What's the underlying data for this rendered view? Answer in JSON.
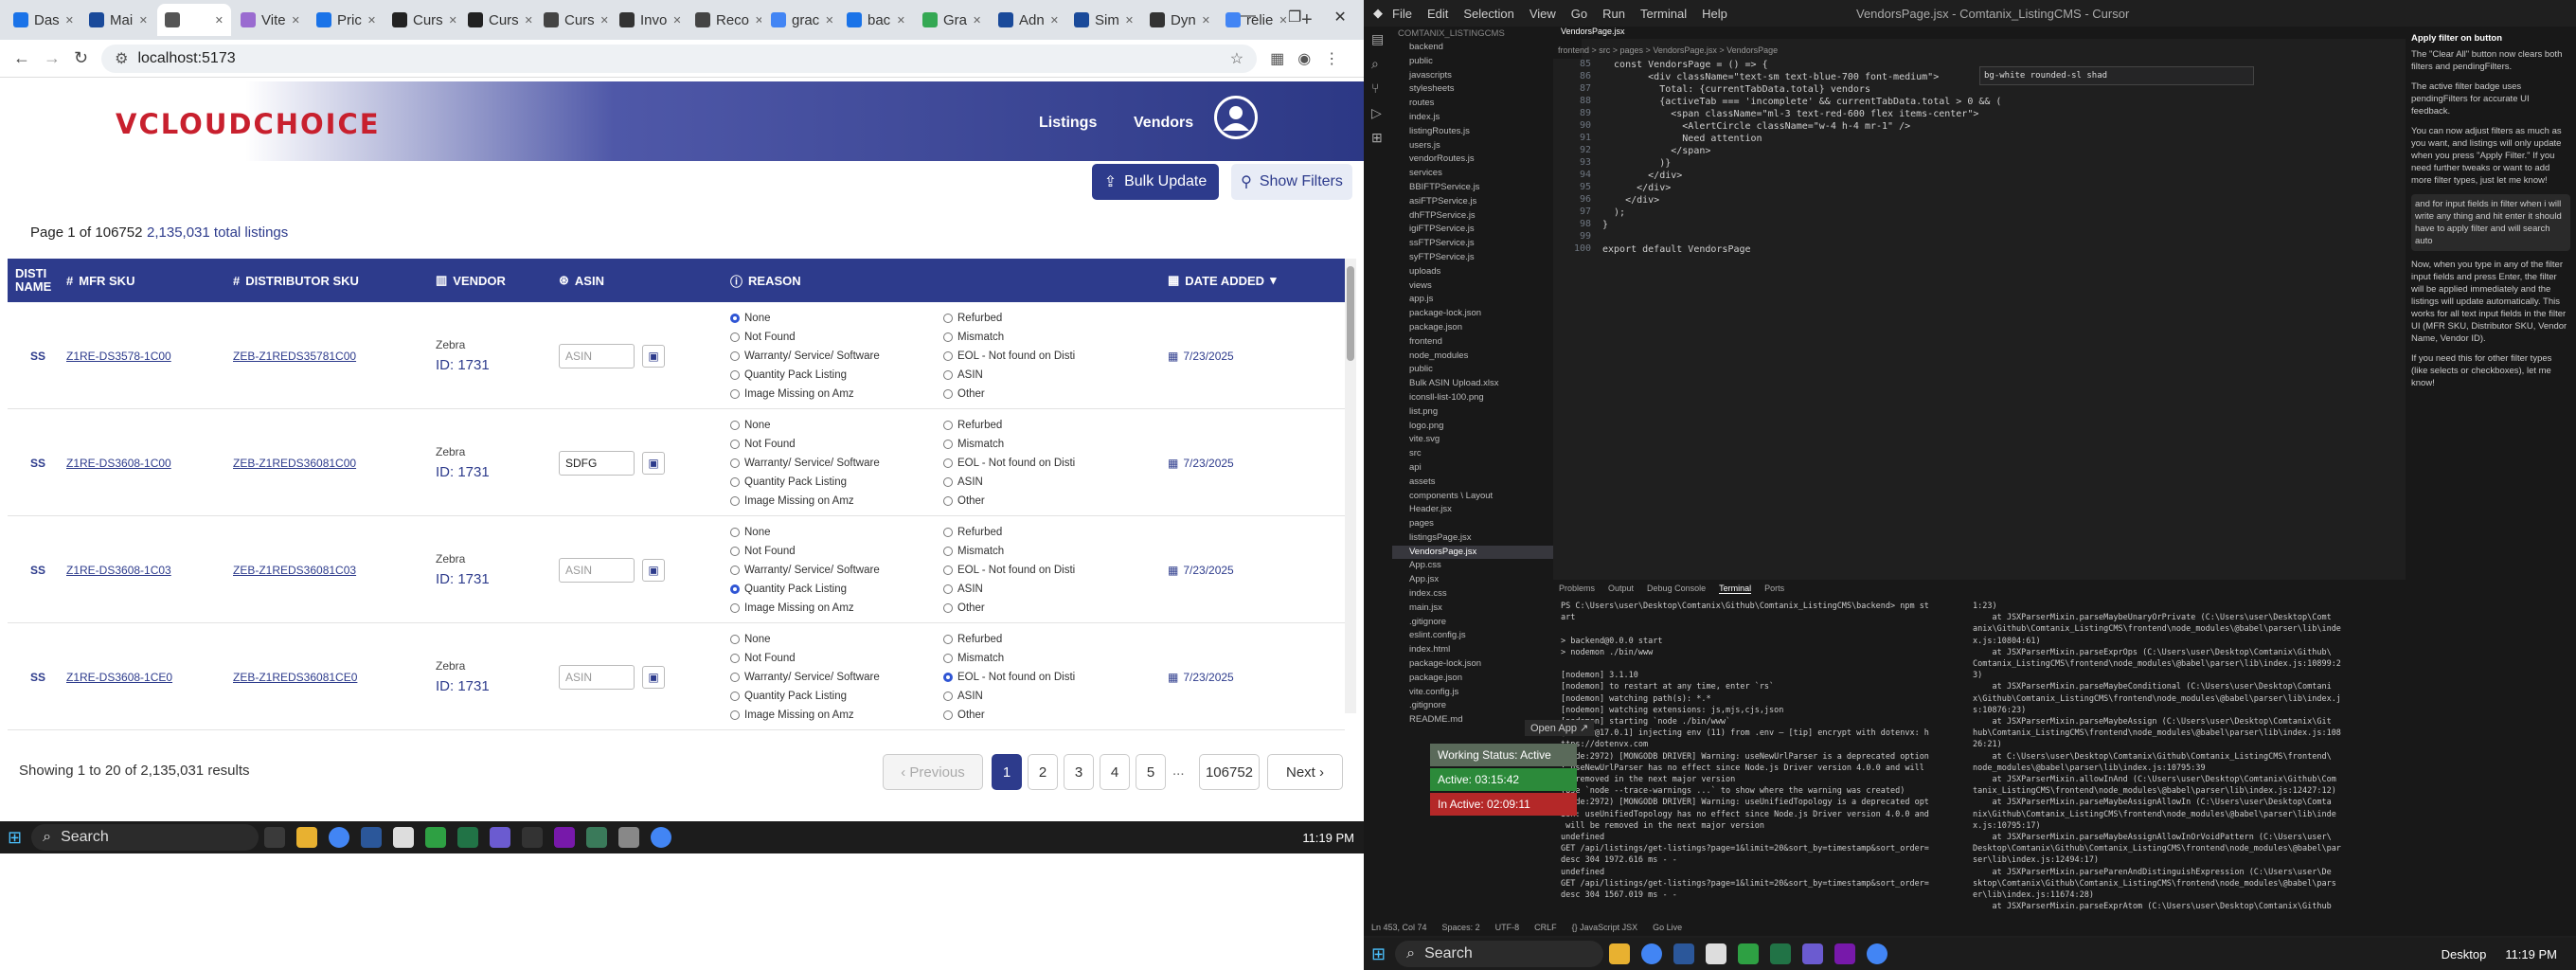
{
  "browser": {
    "tabs": [
      {
        "label": "Das",
        "icon": "globe-icon",
        "color": "#1a73e8"
      },
      {
        "label": "Mai",
        "icon": "mail-icon",
        "color": "#1a4a9a"
      },
      {
        "label": "",
        "icon": "app-icon",
        "color": "#555",
        "active": true
      },
      {
        "label": "Vite",
        "icon": "vite-icon",
        "color": "#9a6bd0"
      },
      {
        "label": "Pric",
        "icon": "price-icon",
        "color": "#1a73e8"
      },
      {
        "label": "Curs",
        "icon": "cursor-icon",
        "color": "#222"
      },
      {
        "label": "Curs",
        "icon": "cursor-icon",
        "color": "#222"
      },
      {
        "label": "Curs",
        "icon": "cursor-icon",
        "color": "#444"
      },
      {
        "label": "Invo",
        "icon": "invoice-icon",
        "color": "#333"
      },
      {
        "label": "Reco",
        "icon": "record-icon",
        "color": "#444"
      },
      {
        "label": "grac",
        "icon": "google-icon",
        "color": "#4285f4"
      },
      {
        "label": "bac",
        "icon": "globe-icon",
        "color": "#1a73e8"
      },
      {
        "label": "Gra",
        "icon": "globe-icon",
        "color": "#34a853"
      },
      {
        "label": "Adn",
        "icon": "admin-icon",
        "color": "#1a4a9a"
      },
      {
        "label": "Sim",
        "icon": "sim-icon",
        "color": "#1a4a9a"
      },
      {
        "label": "Dyn",
        "icon": "dyn-icon",
        "color": "#333"
      },
      {
        "label": "relie",
        "icon": "google-icon",
        "color": "#4285f4"
      }
    ],
    "url": "localhost:5173"
  },
  "app": {
    "logo": "VCLOUDCHOICE",
    "nav": [
      "Listings",
      "Vendors"
    ],
    "bulk_update": "Bulk Update",
    "show_filters": "Show Filters",
    "page_info": "Page 1 of 106752",
    "total_listings": "2,135,031 total listings",
    "columns": [
      "DISTI NAME",
      "MFR SKU",
      "DISTRIBUTOR SKU",
      "VENDOR",
      "ASIN",
      "REASON",
      "DATE ADDED"
    ],
    "reasons_left": [
      "None",
      "Not Found",
      "Warranty/ Service/ Software",
      "Quantity Pack Listing",
      "Image Missing on Amz"
    ],
    "reasons_right": [
      "Refurbed",
      "Mismatch",
      "EOL - Not found on Disti",
      "ASIN",
      "Other"
    ],
    "asin_placeholder": "ASIN",
    "rows": [
      {
        "disti": "SS",
        "mfr": "Z1RE-DS3578-1C00",
        "dsku": "ZEB-Z1REDS35781C00",
        "vendor": "Zebra",
        "vid": "ID: 1731",
        "asin": "",
        "sel": "None",
        "date": "7/23/2025"
      },
      {
        "disti": "SS",
        "mfr": "Z1RE-DS3608-1C00",
        "dsku": "ZEB-Z1REDS36081C00",
        "vendor": "Zebra",
        "vid": "ID: 1731",
        "asin": "SDFG",
        "sel": "",
        "date": "7/23/2025"
      },
      {
        "disti": "SS",
        "mfr": "Z1RE-DS3608-1C03",
        "dsku": "ZEB-Z1REDS36081C03",
        "vendor": "Zebra",
        "vid": "ID: 1731",
        "asin": "",
        "sel": "Quantity Pack Listing",
        "date": "7/23/2025"
      },
      {
        "disti": "SS",
        "mfr": "Z1RE-DS3608-1CE0",
        "dsku": "ZEB-Z1REDS36081CE0",
        "vendor": "Zebra",
        "vid": "ID: 1731",
        "asin": "",
        "sel": "EOL - Not found on Disti",
        "date": "7/23/2025"
      }
    ],
    "showing": "Showing 1 to 20 of 2,135,031 results",
    "pagination": {
      "prev": "‹ Previous",
      "pages": [
        "1",
        "2",
        "3",
        "4",
        "5"
      ],
      "ellipsis": "...",
      "last": "106752",
      "next": "Next ›"
    }
  },
  "taskbar_left": {
    "search": "Search",
    "time": "11:19 PM"
  },
  "taskbar_right": {
    "search": "Search",
    "desktop": "Desktop",
    "time": "11:19 PM"
  },
  "vscode": {
    "title": "VendorsPage.jsx - Comtanix_ListingCMS - Cursor",
    "menu": [
      "File",
      "Edit",
      "Selection",
      "View",
      "Go",
      "Run",
      "Terminal",
      "Help"
    ],
    "active_tab": "VendorsPage.jsx",
    "breadcrumb": "frontend > src > pages > VendorsPage.jsx > VendorsPage",
    "explorer_title": "COMTANIX_LISTINGCMS",
    "tree": [
      "backend",
      "public",
      "javascripts",
      "stylesheets",
      "routes",
      "index.js",
      "listingRoutes.js",
      "users.js",
      "vendorRoutes.js",
      "services",
      "BBIFTPService.js",
      "asiFTPService.js",
      "dhFTPService.js",
      "igiFTPService.js",
      "ssFTPService.js",
      "syFTPService.js",
      "uploads",
      "views",
      "app.js",
      "package-lock.json",
      "package.json",
      "frontend",
      "node_modules",
      "public",
      "Bulk ASIN Upload.xlsx",
      "iconsll-list-100.png",
      "list.png",
      "logo.png",
      "vite.svg",
      "src",
      "api",
      "assets",
      "components \\ Layout",
      "Header.jsx",
      "pages",
      "listingsPage.jsx",
      "VendorsPage.jsx",
      "App.css",
      "App.jsx",
      "index.css",
      "main.jsx",
      ".gitignore",
      "eslint.config.js",
      "index.html",
      "package-lock.json",
      "package.json",
      "vite.config.js",
      ".gitignore",
      "README.md"
    ],
    "code": [
      {
        "n": "85",
        "t": "  const VendorsPage = () => {"
      },
      {
        "n": "86",
        "t": "        <div className=\"text-sm text-blue-700 font-medium\">"
      },
      {
        "n": "87",
        "t": "          Total: {currentTabData.total} vendors"
      },
      {
        "n": "88",
        "t": "          {activeTab === 'incomplete' && currentTabData.total > 0 && ("
      },
      {
        "n": "89",
        "t": "            <span className=\"ml-3 text-red-600 flex items-center\">"
      },
      {
        "n": "90",
        "t": "              <AlertCircle className=\"w-4 h-4 mr-1\" />"
      },
      {
        "n": "91",
        "t": "              Need attention"
      },
      {
        "n": "92",
        "t": "            </span>"
      },
      {
        "n": "93",
        "t": "          )}"
      },
      {
        "n": "94",
        "t": "        </div>"
      },
      {
        "n": "95",
        "t": "      </div>"
      },
      {
        "n": "96",
        "t": "    </div>"
      },
      {
        "n": "97",
        "t": "  );"
      },
      {
        "n": "98",
        "t": "}"
      },
      {
        "n": "99",
        "t": ""
      },
      {
        "n": "100",
        "t": "export default VendorsPage"
      }
    ],
    "find_text": "bg-white rounded-sl shad",
    "panel_tabs": [
      "Problems",
      "Output",
      "Debug Console",
      "Terminal",
      "Ports"
    ],
    "term_left": [
      "PS C:\\Users\\user\\Desktop\\Comtanix\\Github\\Comtanix_ListingCMS\\backend> npm st",
      "art",
      "",
      "> backend@0.0.0 start",
      "> nodemon ./bin/www",
      "",
      "[nodemon] 3.1.10",
      "[nodemon] to restart at any time, enter `rs`",
      "[nodemon] watching path(s): *.*",
      "[nodemon] watching extensions: js,mjs,cjs,json",
      "[nodemon] starting `node ./bin/www`",
      "[dotenv@17.0.1] injecting env (11) from .env – [tip] encrypt with dotenvx: h",
      "ttps://dotenvx.com",
      "(node:2972) [MONGODB DRIVER] Warning: useNewUrlParser is a deprecated option",
      ": useNewUrlParser has no effect since Node.js Driver version 4.0.0 and will",
      "be removed in the next major version",
      "(Use `node --trace-warnings ...` to show where the warning was created)",
      "(node:2972) [MONGODB DRIVER] Warning: useUnifiedTopology is a deprecated opt",
      "ion: useUnifiedTopology has no effect since Node.js Driver version 4.0.0 and",
      " will be removed in the next major version",
      "undefined",
      "GET /api/listings/get-listings?page=1&limit=20&sort_by=timestamp&sort_order=",
      "desc 304 1972.616 ms - -",
      "undefined",
      "GET /api/listings/get-listings?page=1&limit=20&sort_by=timestamp&sort_order=",
      "desc 304 1567.019 ms - -"
    ],
    "term_right": [
      "1:23)",
      "    at JSXParserMixin.parseMaybeUnaryOrPrivate (C:\\Users\\user\\Desktop\\Comt",
      "anix\\Github\\Comtanix_ListingCMS\\frontend\\node_modules\\@babel\\parser\\lib\\inde",
      "x.js:10804:61)",
      "    at JSXParserMixin.parseExprOps (C:\\Users\\user\\Desktop\\Comtanix\\Github\\",
      "Comtanix_ListingCMS\\frontend\\node_modules\\@babel\\parser\\lib\\index.js:10899:2",
      "3)",
      "    at JSXParserMixin.parseMaybeConditional (C:\\Users\\user\\Desktop\\Comtani",
      "x\\Github\\Comtanix_ListingCMS\\frontend\\node_modules\\@babel\\parser\\lib\\index.j",
      "s:10876:23)",
      "    at JSXParserMixin.parseMaybeAssign (C:\\Users\\user\\Desktop\\Comtanix\\Git",
      "hub\\Comtanix_ListingCMS\\frontend\\node_modules\\@babel\\parser\\lib\\index.js:108",
      "26:21)",
      "    at C:\\Users\\user\\Desktop\\Comtanix\\Github\\Comtanix_ListingCMS\\frontend\\",
      "node_modules\\@babel\\parser\\lib\\index.js:10795:39",
      "    at JSXParserMixin.allowInAnd (C:\\Users\\user\\Desktop\\Comtanix\\Github\\Com",
      "tanix_ListingCMS\\frontend\\node_modules\\@babel\\parser\\lib\\index.js:12427:12)",
      "    at JSXParserMixin.parseMaybeAssignAllowIn (C:\\Users\\user\\Desktop\\Comta",
      "nix\\Github\\Comtanix_ListingCMS\\frontend\\node_modules\\@babel\\parser\\lib\\inde",
      "x.js:10795:17)",
      "    at JSXParserMixin.parseMaybeAssignAllowInOrVoidPattern (C:\\Users\\user\\",
      "Desktop\\Comtanix\\Github\\Comtanix_ListingCMS\\frontend\\node_modules\\@babel\\par",
      "ser\\lib\\index.js:12494:17)",
      "    at JSXParserMixin.parseParenAndDistinguishExpression (C:\\Users\\user\\De",
      "sktop\\Comtanix\\Github\\Comtanix_ListingCMS\\frontend\\node_modules\\@babel\\pars",
      "er\\lib\\index.js:11674:28)",
      "    at JSXParserMixin.parseExprAtom (C:\\Users\\user\\Desktop\\Comtanix\\Github"
    ],
    "work": {
      "status": "Working Status: Active",
      "active": "Active: 03:15:42",
      "inactive": "In Active: 02:09:11"
    },
    "open_app": "Open App ↗",
    "chat_title": "Apply filter on button",
    "chat": [
      "The \"Clear All\" button now clears both filters and pendingFilters.",
      "The active filter badge uses pendingFilters for accurate UI feedback.",
      "You can now adjust filters as much as you want, and listings will only update when you press \"Apply Filter.\" If you need further tweaks or want to add more filter types, just let me know!",
      "and for input fields in filter when i will write any thing and hit enter it should have to apply filter and will search auto",
      "Now, when you type in any of the filter input fields and press Enter, the filter will be applied immediately and the listings will update automatically. This works for all text input fields in the filter UI (MFR SKU, Distributor SKU, Vendor Name, Vendor ID).",
      "If you need this for other filter types (like selects or checkboxes), let me know!"
    ],
    "status": [
      "Ln 453, Col 74",
      "Spaces: 2",
      "UTF-8",
      "CRLF",
      "{} JavaScript JSX",
      "Go Live"
    ]
  }
}
